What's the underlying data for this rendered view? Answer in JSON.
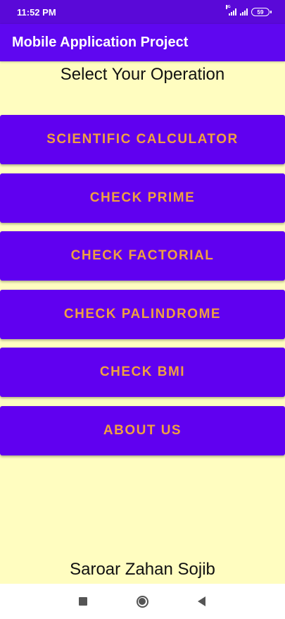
{
  "status_bar": {
    "time": "11:52 PM",
    "network": "4G",
    "battery": "59"
  },
  "app_bar": {
    "title": "Mobile Application Project"
  },
  "main": {
    "heading": "Select Your Operation",
    "buttons": [
      {
        "label": "SCIENTIFIC CALCULATOR"
      },
      {
        "label": "CHECK PRIME"
      },
      {
        "label": "CHECK FACTORIAL"
      },
      {
        "label": "CHECK PALINDROME"
      },
      {
        "label": "CHECK BMI"
      },
      {
        "label": "ABOUT US"
      }
    ],
    "footer_name": "Saroar Zahan Sojib"
  },
  "nav_bar": {
    "icons": [
      "recents-icon",
      "home-icon",
      "back-icon"
    ]
  },
  "colors": {
    "status_bar": "#5a09d8",
    "app_bar": "#5f07f0",
    "background": "#fffdc0",
    "button": "#6000f0",
    "button_text": "#f0a040"
  }
}
